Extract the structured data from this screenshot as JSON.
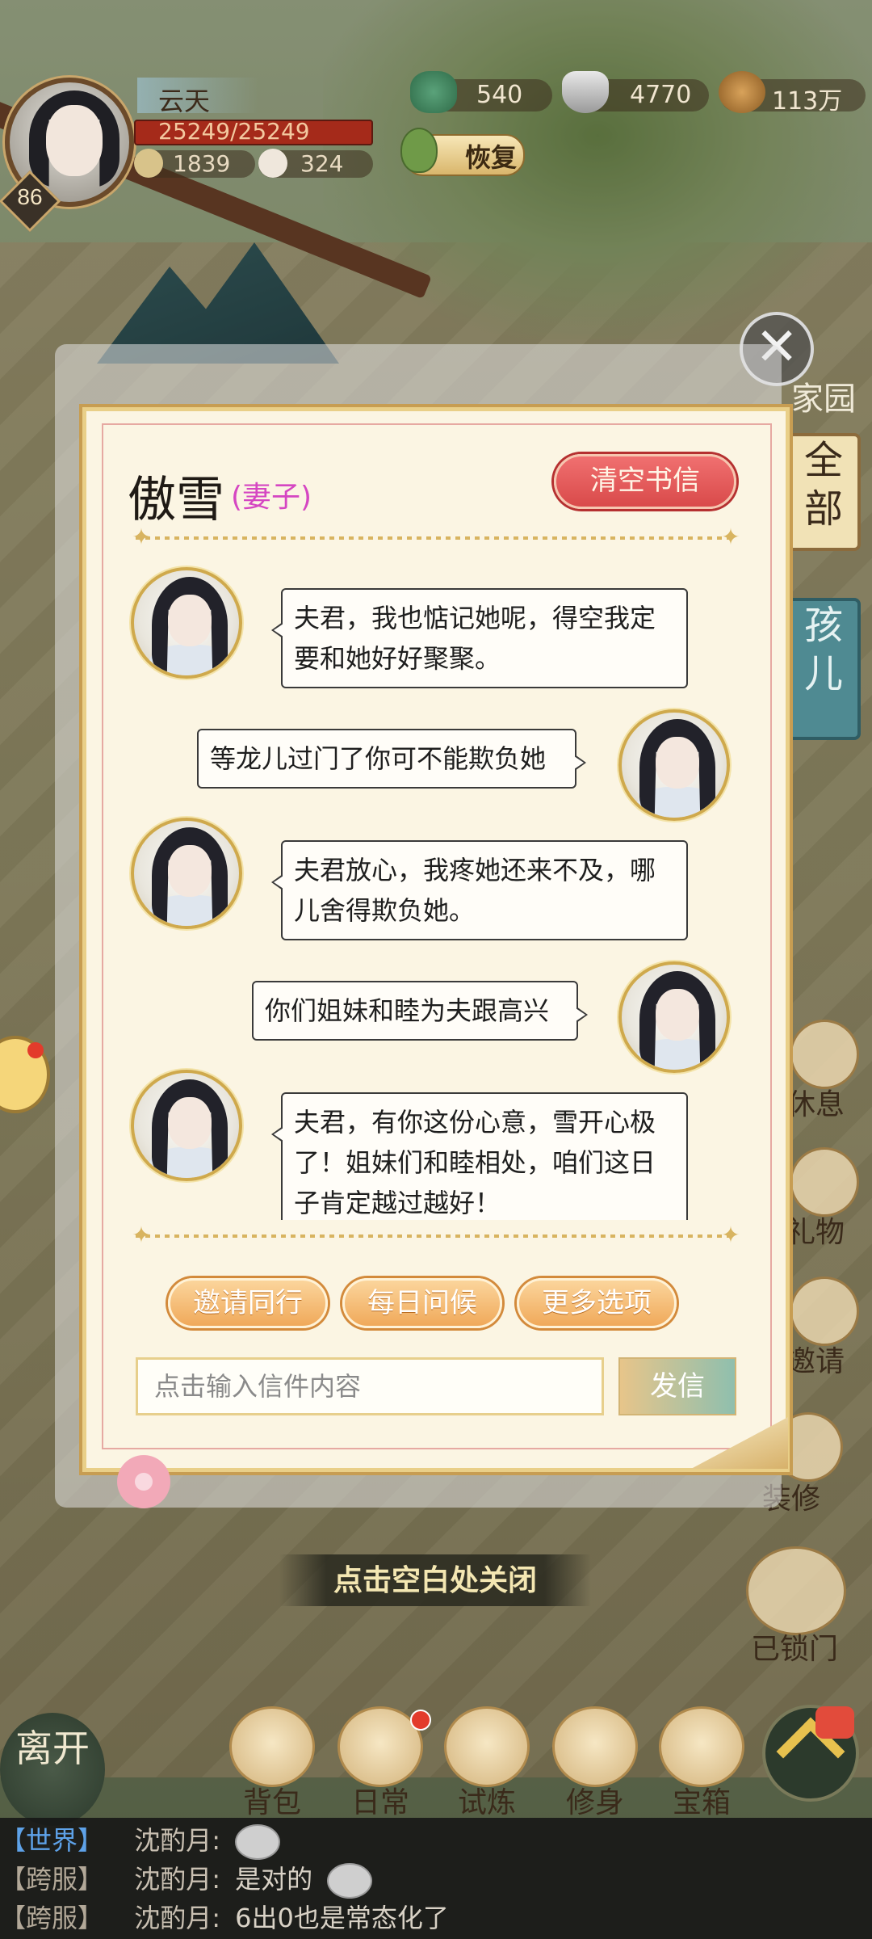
{
  "hud": {
    "player_name": "云天",
    "level": "86",
    "hp": "25249/25249",
    "stat_1": "1839",
    "stat_2": "324",
    "resource_1": "540",
    "resource_2": "4770",
    "resource_3": "113万",
    "restore_label": "恢复"
  },
  "side": {
    "home_label": "家园",
    "tab_all": "全部",
    "tab_kids": "孩儿",
    "rest_label": "休息",
    "gift_label": "礼物",
    "invite_label": "邀请",
    "repair_label": "装修",
    "locked_label": "已锁门"
  },
  "letter": {
    "name": "傲雪",
    "role": "(妻子)",
    "clear_label": "清空书信",
    "messages": [
      {
        "side": "left",
        "text": "夫君，我也惦记她呢，得空我定要和她好好聚聚。"
      },
      {
        "side": "right",
        "text": "等龙儿过门了你可不能欺负她"
      },
      {
        "side": "left",
        "text": "夫君放心，我疼她还来不及，哪儿舍得欺负她。"
      },
      {
        "side": "right",
        "text": "你们姐妹和睦为夫跟高兴"
      },
      {
        "side": "left",
        "text": "夫君，有你这份心意，雪开心极了！姐妹们和睦相处，咱们这日子肯定越过越好！"
      }
    ],
    "options": [
      "邀请同行",
      "每日问候",
      "更多选项"
    ],
    "input_placeholder": "点击输入信件内容",
    "send_label": "发信"
  },
  "close_hint": "点击空白处关闭",
  "nav": {
    "leave": "离开",
    "items": [
      "背包",
      "日常",
      "试炼",
      "修身",
      "宝箱"
    ]
  },
  "chat": [
    {
      "channel": "【世界】",
      "user": "沈酌月:",
      "text": ""
    },
    {
      "channel": "【跨服】",
      "user": "沈酌月:",
      "text": "是对的"
    },
    {
      "channel": "【跨服】",
      "user": "沈酌月:",
      "text": "6出0也是常态化了"
    }
  ],
  "colors": {
    "hp_bar": "#a52a1a",
    "clear_button": "#d94a4a",
    "role_text": "#d546c2",
    "option_button": "#f0a95a",
    "world_channel": "#5ea2e8"
  }
}
